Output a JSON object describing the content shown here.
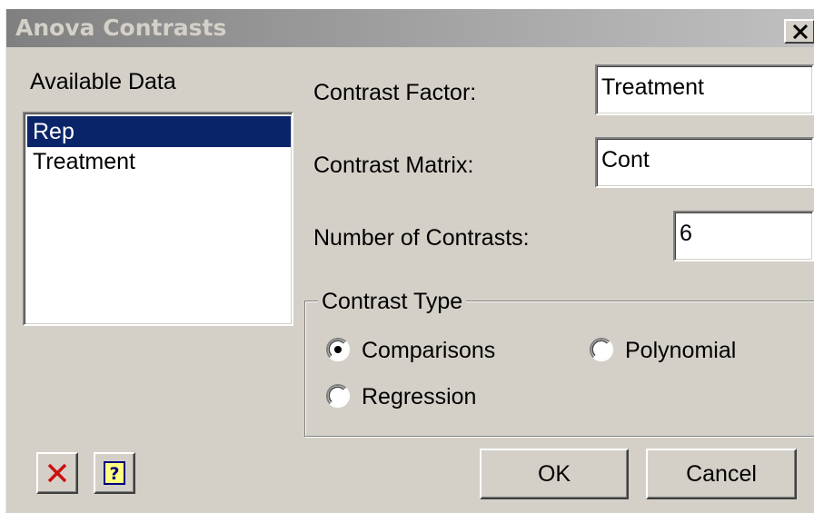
{
  "window": {
    "title": "Anova Contrasts",
    "close_glyph": "X"
  },
  "available_data": {
    "label": "Available Data",
    "items": [
      "Rep",
      "Treatment"
    ],
    "selected_index": 0
  },
  "fields": {
    "contrast_factor": {
      "label": "Contrast Factor:",
      "value": "Treatment"
    },
    "contrast_matrix": {
      "label": "Contrast Matrix:",
      "value": "Cont"
    },
    "number_of_contrasts": {
      "label": "Number of Contrasts:",
      "value": "6"
    }
  },
  "contrast_type": {
    "legend": "Contrast Type",
    "options": [
      "Comparisons",
      "Polynomial",
      "Regression"
    ],
    "selected": "Comparisons"
  },
  "buttons": {
    "ok": "OK",
    "cancel": "Cancel"
  },
  "icons": {
    "clear": "red-x-icon",
    "help": "help-question-icon"
  },
  "colors": {
    "dialog_bg": "#d4d0c8",
    "selection": "#0a246a",
    "clear_icon_red": "#cc1010",
    "help_icon_bg": "#ffff80",
    "help_icon_fg": "#000080"
  }
}
